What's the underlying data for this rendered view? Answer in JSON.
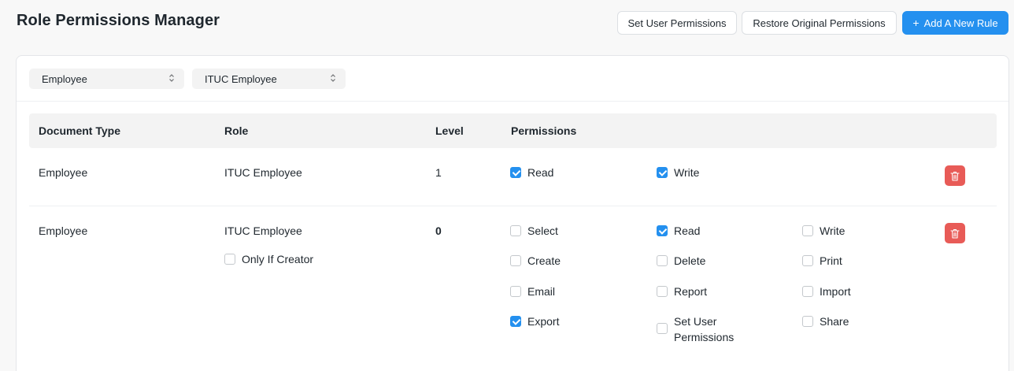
{
  "header": {
    "title": "Role Permissions Manager",
    "set_user_permissions": "Set User Permissions",
    "restore_original": "Restore Original Permissions",
    "add_new_rule": "Add A New Rule"
  },
  "filters": {
    "doctype": "Employee",
    "role": "ITUC Employee"
  },
  "table": {
    "headers": {
      "doctype": "Document Type",
      "role": "Role",
      "level": "Level",
      "permissions": "Permissions"
    },
    "rows": [
      {
        "doctype": "Employee",
        "role": "ITUC Employee",
        "level": "1",
        "permissions": [
          {
            "label": "Read",
            "checked": true
          },
          {
            "label": "Write",
            "checked": true
          }
        ]
      },
      {
        "doctype": "Employee",
        "role": "ITUC Employee",
        "level": "0",
        "only_if_creator": {
          "label": "Only If Creator",
          "checked": false
        },
        "permissions": [
          {
            "label": "Select",
            "checked": false
          },
          {
            "label": "Read",
            "checked": true
          },
          {
            "label": "Write",
            "checked": false
          },
          {
            "label": "Create",
            "checked": false
          },
          {
            "label": "Delete",
            "checked": false
          },
          {
            "label": "Print",
            "checked": false
          },
          {
            "label": "Email",
            "checked": false
          },
          {
            "label": "Report",
            "checked": false
          },
          {
            "label": "Import",
            "checked": false
          },
          {
            "label": "Export",
            "checked": true
          },
          {
            "label": "Set User Permissions",
            "checked": false
          },
          {
            "label": "Share",
            "checked": false
          }
        ]
      }
    ]
  },
  "colors": {
    "primary": "#2490ef",
    "danger": "#e85b57"
  },
  "icons": {
    "delete": "trash-icon",
    "add": "plus-icon",
    "select": "chevron-up-down-icon"
  }
}
